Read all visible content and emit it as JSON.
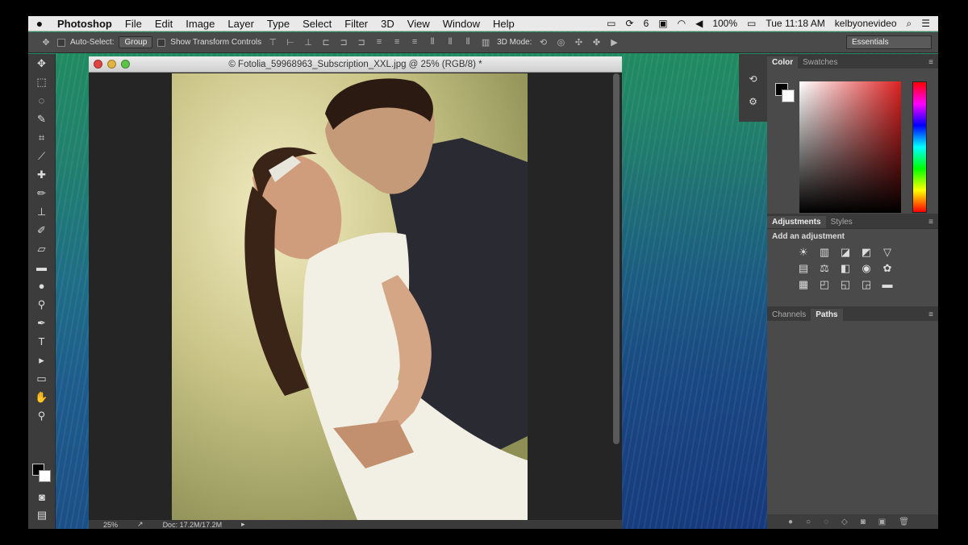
{
  "menubar": {
    "apple": "",
    "app_name": "Photoshop",
    "items": [
      "File",
      "Edit",
      "Image",
      "Layer",
      "Type",
      "Select",
      "Filter",
      "3D",
      "View",
      "Window",
      "Help"
    ],
    "status": {
      "badge": "6",
      "battery": "100%",
      "clock": "Tue 11:18 AM",
      "user": "kelbyonevideo"
    }
  },
  "options_bar": {
    "auto_select_label": "Auto-Select:",
    "auto_select_value": "Group",
    "transform_label": "Show Transform Controls",
    "mode_label": "3D Mode:",
    "workspace": "Essentials"
  },
  "document": {
    "title": "© Fotolia_59968963_Subscription_XXL.jpg @ 25% (RGB/8) *",
    "zoom": "25%",
    "doc_size": "Doc: 17.2M/17.2M"
  },
  "panels": {
    "color_tabs": [
      "Color",
      "Swatches"
    ],
    "adjustments_tabs": [
      "Adjustments",
      "Styles"
    ],
    "adjustments_label": "Add an adjustment",
    "paths_tabs": [
      "Channels",
      "Paths"
    ]
  },
  "colors": {
    "foreground": "#000000",
    "background": "#ffffff",
    "accent": "#d22222"
  }
}
